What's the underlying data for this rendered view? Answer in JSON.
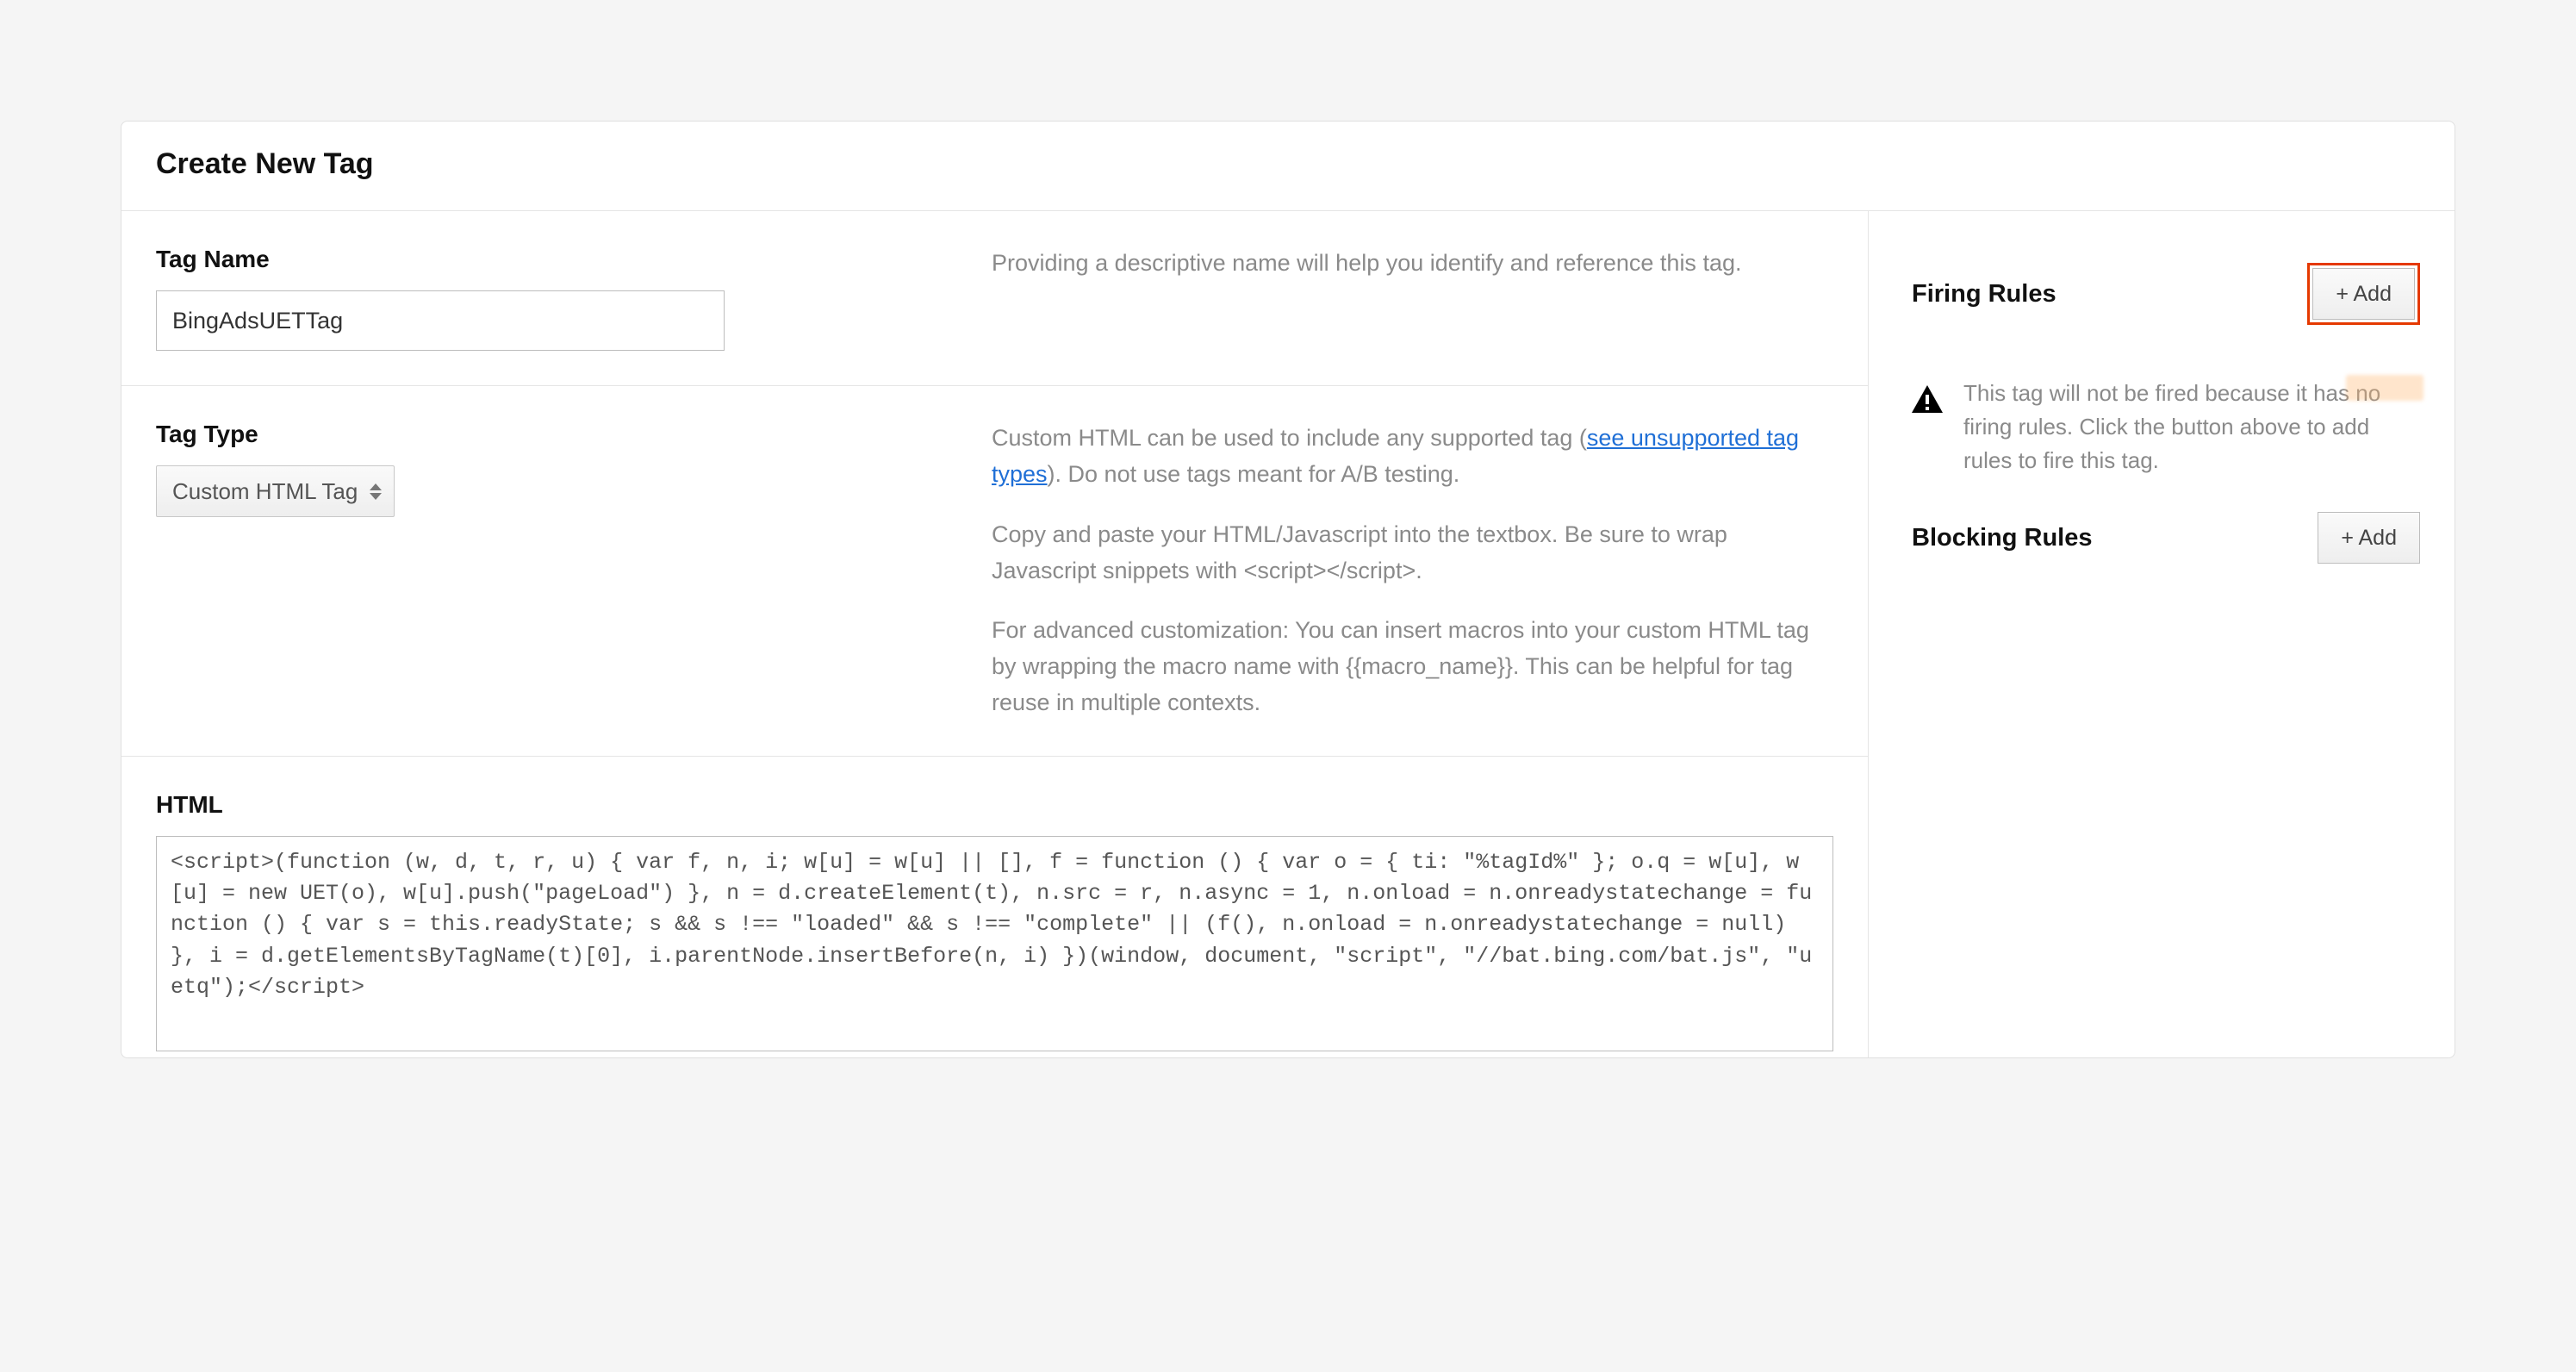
{
  "header": {
    "title": "Create New Tag"
  },
  "tagName": {
    "label": "Tag Name",
    "value": "BingAdsUETTag",
    "help": "Providing a descriptive name will help you identify and reference this tag."
  },
  "tagType": {
    "label": "Tag Type",
    "selected": "Custom HTML Tag",
    "help1_pre": "Custom HTML can be used to include any supported tag (",
    "help1_link": "see unsupported tag types",
    "help1_post": "). Do not use tags meant for A/B testing.",
    "help2": "Copy and paste your HTML/Javascript into the textbox. Be sure to wrap Javascript snippets with <script></script>.",
    "help3": "For advanced customization: You can insert macros into your custom HTML tag by wrapping the macro name with {{macro_name}}. This can be helpful for tag reuse in multiple contexts."
  },
  "html": {
    "label": "HTML",
    "value": "<script>(function (w, d, t, r, u) { var f, n, i; w[u] = w[u] || [], f = function () { var o = { ti: \"%tagId%\" }; o.q = w[u], w[u] = new UET(o), w[u].push(\"pageLoad\") }, n = d.createElement(t), n.src = r, n.async = 1, n.onload = n.onreadystatechange = function () { var s = this.readyState; s && s !== \"loaded\" && s !== \"complete\" || (f(), n.onload = n.onreadystatechange = null) }, i = d.getElementsByTagName(t)[0], i.parentNode.insertBefore(n, i) })(window, document, \"script\", \"//bat.bing.com/bat.js\", \"uetq\");</script>"
  },
  "firing": {
    "heading": "Firing Rules",
    "addLabel": "+ Add",
    "warning": "This tag will not be fired because it has no firing rules. Click the button above to add rules to fire this tag."
  },
  "blocking": {
    "heading": "Blocking Rules",
    "addLabel": "+ Add"
  }
}
